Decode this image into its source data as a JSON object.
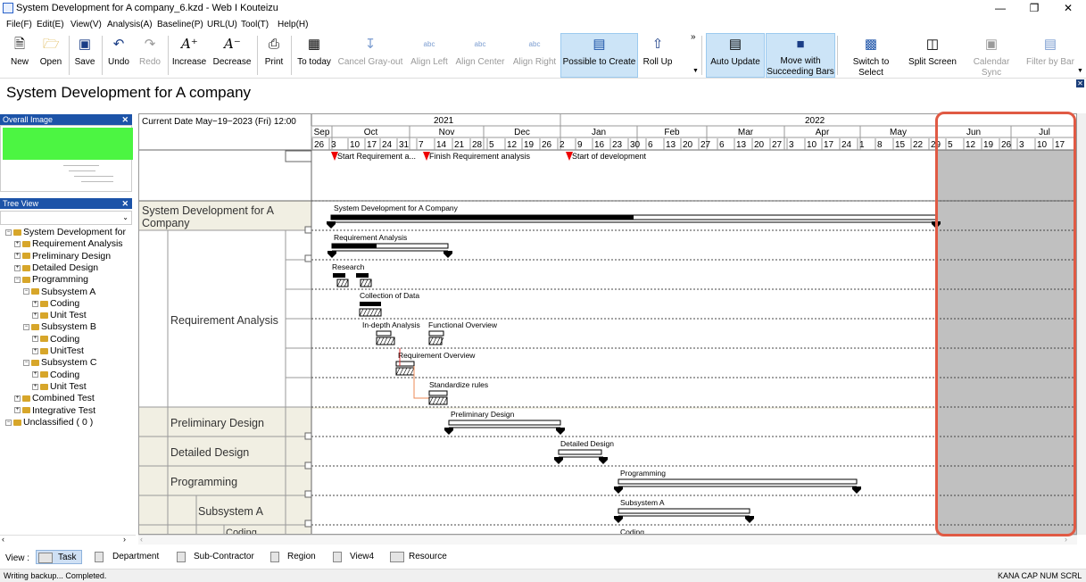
{
  "window": {
    "title": "System Development for A company_6.kzd - Web I Kouteizu"
  },
  "menu": [
    "File(F)",
    "Edit(E)",
    "View(V)",
    "Analysis(A)",
    "Baseline(P)",
    "URL(U)",
    "Tool(T)",
    "Help(H)"
  ],
  "toolbar": [
    {
      "label": "New",
      "icon": "new-document-icon",
      "state": "enabled"
    },
    {
      "label": "Open",
      "icon": "open-folder-icon",
      "state": "enabled"
    },
    {
      "label": "Save",
      "icon": "save-disk-icon",
      "state": "enabled"
    },
    {
      "label": "Undo",
      "icon": "undo-arrow-icon",
      "state": "enabled"
    },
    {
      "label": "Redo",
      "icon": "redo-arrow-icon",
      "state": "disabled"
    },
    {
      "label": "Increase",
      "icon": "font-increase-icon",
      "state": "enabled"
    },
    {
      "label": "Decrease",
      "icon": "font-decrease-icon",
      "state": "enabled"
    },
    {
      "label": "Print",
      "icon": "print-icon",
      "state": "enabled"
    },
    {
      "label": "To today",
      "icon": "today-icon",
      "state": "enabled"
    },
    {
      "label": "Cancel Gray-out",
      "icon": "cancel-grayout-icon",
      "state": "disabled"
    },
    {
      "label": "Align Left",
      "icon": "align-left-icon",
      "state": "disabled"
    },
    {
      "label": "Align Center",
      "icon": "align-center-icon",
      "state": "disabled"
    },
    {
      "label": "Align Right",
      "icon": "align-right-icon",
      "state": "disabled"
    },
    {
      "label": "Possible to Create",
      "icon": "possible-to-create-icon",
      "state": "active"
    },
    {
      "label": "Roll Up",
      "icon": "roll-up-icon",
      "state": "enabled"
    },
    {
      "label": "Auto Update",
      "icon": "auto-update-icon",
      "state": "active"
    },
    {
      "label": "Move with Succeeding Bars",
      "icon": "move-succeeding-icon",
      "state": "active"
    },
    {
      "label": "Switch to Select",
      "icon": "switch-select-icon",
      "state": "enabled"
    },
    {
      "label": "Split Screen",
      "icon": "split-screen-icon",
      "state": "enabled"
    },
    {
      "label": "Calendar Sync",
      "icon": "calendar-sync-icon",
      "state": "disabled"
    },
    {
      "label": "Filter by Bar",
      "icon": "filter-bar-icon",
      "state": "disabled"
    }
  ],
  "document": {
    "title": "System Development for A company"
  },
  "panes": {
    "overall_image": "Overall Image",
    "tree_view": "Tree View"
  },
  "tree": [
    {
      "label": "System Development for",
      "depth": 0,
      "box": "−"
    },
    {
      "label": "Requirement Analysis",
      "depth": 1,
      "box": "+"
    },
    {
      "label": "Preliminary Design",
      "depth": 1,
      "box": "+"
    },
    {
      "label": "Detailed Design",
      "depth": 1,
      "box": "+"
    },
    {
      "label": "Programming",
      "depth": 1,
      "box": "−"
    },
    {
      "label": "Subsystem A",
      "depth": 2,
      "box": "−"
    },
    {
      "label": "Coding",
      "depth": 3,
      "box": "+"
    },
    {
      "label": "Unit Test",
      "depth": 3,
      "box": "+"
    },
    {
      "label": "Subsystem B",
      "depth": 2,
      "box": "−"
    },
    {
      "label": "Coding",
      "depth": 3,
      "box": "+"
    },
    {
      "label": "UnitTest",
      "depth": 3,
      "box": "+"
    },
    {
      "label": "Subsystem C",
      "depth": 2,
      "box": "−"
    },
    {
      "label": "Coding",
      "depth": 3,
      "box": "+"
    },
    {
      "label": "Unit Test",
      "depth": 3,
      "box": "+"
    },
    {
      "label": "Combined Test",
      "depth": 1,
      "box": "+"
    },
    {
      "label": "Integrative Test",
      "depth": 1,
      "box": "+"
    },
    {
      "label": "Unclassified ( 0 )",
      "depth": 0,
      "box": "−"
    }
  ],
  "gantt": {
    "current_date": "Current Date May−19−2023 (Fri) 12:00",
    "years": [
      "2021",
      "2022"
    ],
    "months": [
      "Sep",
      "Oct",
      "Nov",
      "Dec",
      "Jan",
      "Feb",
      "Mar",
      "Apr",
      "May",
      "Jun",
      "Jul"
    ],
    "days": [
      "26",
      "3",
      "10",
      "17",
      "24",
      "31",
      "7",
      "14",
      "21",
      "28",
      "5",
      "12",
      "19",
      "26",
      "2",
      "9",
      "16",
      "23",
      "30",
      "6",
      "13",
      "20",
      "27",
      "6",
      "13",
      "20",
      "27",
      "3",
      "10",
      "17",
      "24",
      "1",
      "8",
      "15",
      "22",
      "29",
      "5",
      "12",
      "19",
      "26",
      "3",
      "10",
      "17"
    ],
    "milestones": [
      "Start Requirement a...",
      "Finish Requirement analysis",
      "Start of development"
    ],
    "rows": [
      {
        "label": "System Development for A Company",
        "bar_label": "System Development for A Company"
      },
      {
        "label": "Requirement Analysis",
        "bar_label": "Requirement Analysis"
      },
      {
        "label": "",
        "bar_label": "Research"
      },
      {
        "label": "",
        "bar_label": "Collection of Data"
      },
      {
        "label": "",
        "bar_label": "In-depth Analysis"
      },
      {
        "label": "",
        "bar_label": "Functional Overview"
      },
      {
        "label": "",
        "bar_label": "Requirement Overview"
      },
      {
        "label": "",
        "bar_label": "Standardize rules"
      },
      {
        "label": "Preliminary Design",
        "bar_label": "Preliminary Design"
      },
      {
        "label": "Detailed Design",
        "bar_label": "Detailed Design"
      },
      {
        "label": "Programming",
        "bar_label": "Programming"
      },
      {
        "label": "Subsystem A",
        "bar_label": "Subsystem A"
      },
      {
        "label": "Coding",
        "bar_label": "Coding"
      }
    ]
  },
  "view_tabs": [
    "Task",
    "Department",
    "Sub-Contractor",
    "Region",
    "View4",
    "Resource"
  ],
  "view_label": "View :",
  "status": {
    "message": "Writing backup... Completed.",
    "indicators": "KANA CAP NUM SCRL"
  },
  "colors": {
    "accent": "#1c53a8",
    "highlight_box": "#e05a44",
    "future_shade": "#c0c0c0",
    "overview_green": "#4cf542"
  }
}
